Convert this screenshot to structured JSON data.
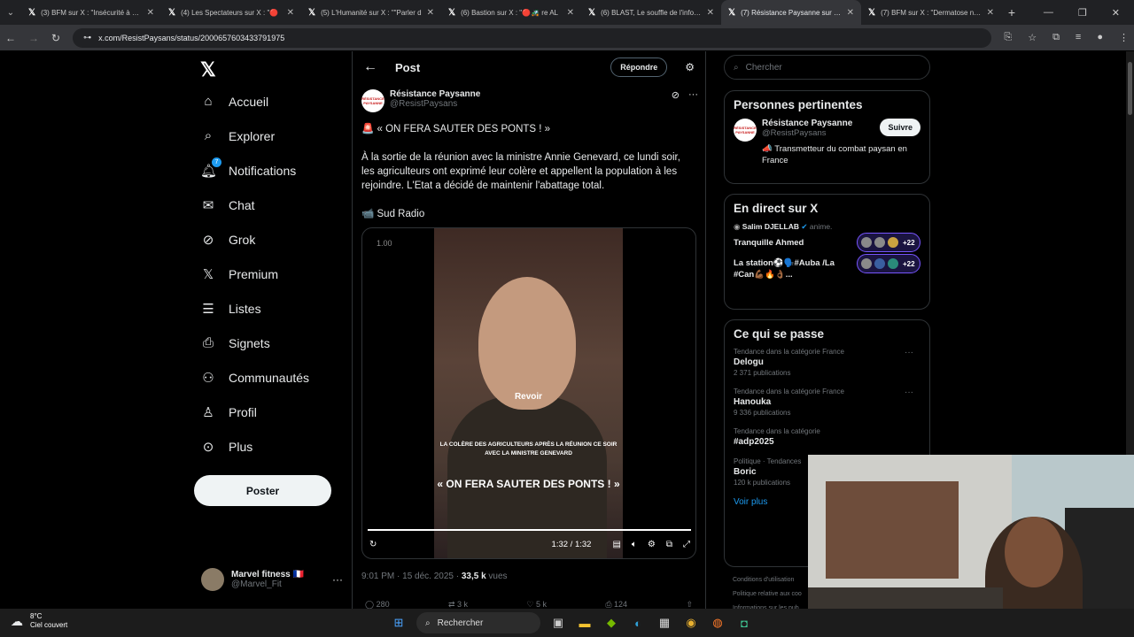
{
  "browser": {
    "tabs": [
      {
        "title": "(3) BFM sur X : \"Insécurité à Ma",
        "active": false
      },
      {
        "title": "(4) Les Spectateurs sur X : \"🔴",
        "active": false
      },
      {
        "title": "(5) L'Humanité sur X : \"\"Parler d",
        "active": false
      },
      {
        "title": "(6) Bastion sur X : \"🔴🚜 re AL",
        "active": false
      },
      {
        "title": "(6) BLAST, Le souffle de l'info su",
        "active": false
      },
      {
        "title": "(7) Résistance Paysanne sur X :",
        "active": true
      },
      {
        "title": "(7) BFM sur X : \"Dermatose nod",
        "active": false
      }
    ],
    "url": "x.com/ResistPaysans/status/2000657603433791975"
  },
  "nav": {
    "items": [
      {
        "label": "Accueil",
        "icon": "home-icon"
      },
      {
        "label": "Explorer",
        "icon": "search-icon"
      },
      {
        "label": "Notifications",
        "icon": "bell-icon",
        "badge": "7"
      },
      {
        "label": "Chat",
        "icon": "mail-icon"
      },
      {
        "label": "Grok",
        "icon": "grok-icon"
      },
      {
        "label": "Premium",
        "icon": "x-icon"
      },
      {
        "label": "Listes",
        "icon": "list-icon"
      },
      {
        "label": "Signets",
        "icon": "bookmark-icon"
      },
      {
        "label": "Communautés",
        "icon": "community-icon"
      },
      {
        "label": "Profil",
        "icon": "profile-icon"
      },
      {
        "label": "Plus",
        "icon": "more-icon"
      }
    ],
    "post_button": "Poster",
    "user": {
      "name": "Marvel fitness 🇫🇷",
      "handle": "@Marvel_Fit"
    }
  },
  "main": {
    "header_title": "Post",
    "reply_button": "Répondre",
    "author": {
      "name": "Résistance Paysanne",
      "handle": "@ResistPaysans",
      "avatar_text": "RÉSISTANCE PAYSANNE"
    },
    "text_1": "🚨 « ON FERA SAUTER DES PONTS ! »",
    "text_2": "À la sortie de la réunion avec la ministre Annie Genevard, ce lundi soir, les agriculteurs ont exprimé leur colère et appellent la population à les rejoindre. L'Etat a décidé de maintenir l'abattage total.",
    "text_3": "📹 Sud Radio",
    "video": {
      "speed": "1.00",
      "replay_label": "Revoir",
      "caption_small": "LA COLÈRE DES AGRICULTEURS APRÈS LA RÉUNION CE SOIR AVEC LA MINISTRE GENEVARD",
      "caption_big": "« ON FERA SAUTER DES PONTS ! »",
      "time": "1:32 / 1:32",
      "progress": 1.0
    },
    "meta_time": "9:01 PM · 15 déc. 2025 · ",
    "meta_views": "33,5 k",
    "meta_views_label": " vues",
    "actions": [
      "280",
      "3 k",
      "5 k",
      "124"
    ]
  },
  "sidebar": {
    "search_placeholder": "Chercher",
    "relevant": {
      "title": "Personnes pertinentes",
      "name": "Résistance Paysanne",
      "handle": "@ResistPaysans",
      "follow": "Suivre",
      "bio": "📣 Transmetteur du combat paysan en France"
    },
    "live": {
      "title": "En direct sur X",
      "items": [
        {
          "host": "Salim DJELLAB",
          "host_suffix": "anime.",
          "title": "Tranquille Ahmed",
          "more": "+22"
        },
        {
          "host": "",
          "host_suffix": "",
          "title": "La station⚽🗣️#Auba /La #Can💪🏾🔥👌🏾...",
          "more": "+22"
        }
      ]
    },
    "trends": {
      "title": "Ce qui se passe",
      "items": [
        {
          "cat": "Tendance dans la catégorie France",
          "name": "Delogu",
          "count": "2 371 publications"
        },
        {
          "cat": "Tendance dans la catégorie France",
          "name": "Hanouka",
          "count": "9 336 publications"
        },
        {
          "cat": "Tendance dans la catégorie",
          "name": "#adp2025",
          "count": ""
        },
        {
          "cat": "Politique · Tendances",
          "name": "Boric",
          "count": "120 k publications"
        }
      ],
      "show_more": "Voir plus"
    },
    "footer": [
      "Conditions d'utilisation",
      "Politique relative aux coo",
      "Informations sur les pub"
    ]
  },
  "taskbar": {
    "temp": "8°C",
    "weather": "Ciel couvert",
    "search": "Rechercher"
  }
}
